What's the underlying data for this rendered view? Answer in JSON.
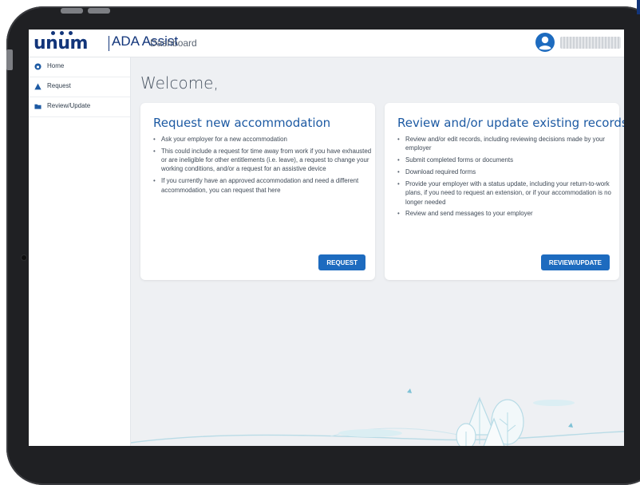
{
  "app": {
    "brand": "unum",
    "product": "ADA Assist",
    "section": "Dashboard"
  },
  "user": {
    "avatar_icon": "user-circle-icon"
  },
  "sidebar": {
    "items": [
      {
        "label": "Home",
        "icon": "home-icon"
      },
      {
        "label": "Request",
        "icon": "warning-icon"
      },
      {
        "label": "Review/Update",
        "icon": "folder-icon"
      }
    ]
  },
  "main": {
    "welcome": "Welcome,",
    "cards": [
      {
        "title": "Request new accommodation",
        "bullets": [
          "Ask your employer for a new accommodation",
          "This could include a request for time away from work if you have exhausted or are ineligible for other entitlements (i.e. leave), a request to change your working conditions, and/or a request for an assistive device",
          "If you currently have an approved accommodation and need a different accommodation, you can request that here"
        ],
        "button": "REQUEST"
      },
      {
        "title": "Review and/or update existing records",
        "bullets": [
          "Review and/or edit records, including reviewing decisions made by your employer",
          "Submit completed forms or documents",
          "Download required forms",
          "Provide your employer with a status update, including your return-to-work plans, if you need to request an extension, or if your accommodation is no longer needed",
          "Review and send messages to your employer"
        ],
        "button": "REVIEW/UPDATE"
      }
    ]
  },
  "colors": {
    "brand": "#12357a",
    "accent": "#1d6bbf",
    "title": "#1d5aa3",
    "background": "#eef0f3"
  }
}
